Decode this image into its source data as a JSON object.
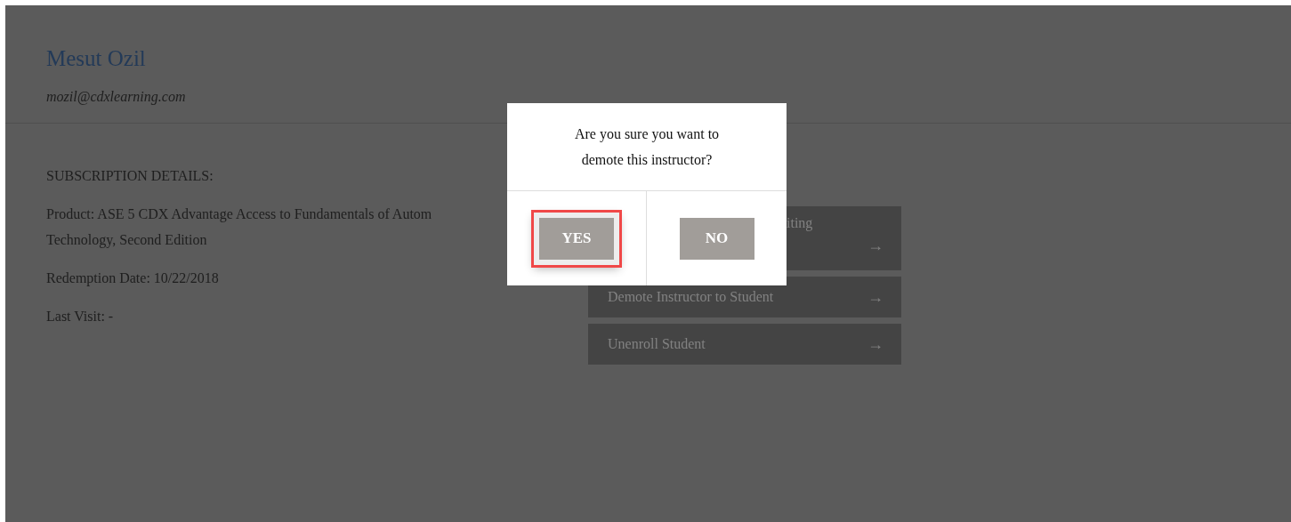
{
  "profile": {
    "name": "Mesut Ozil",
    "email": "mozil@cdxlearning.com"
  },
  "subscription": {
    "heading": "SUBSCRIPTION DETAILS:",
    "product_lines": [
      "Product: ASE 5 CDX Advantage Access to Fundamentals of Autom",
      "Technology, Second Edition"
    ],
    "redemption": "Redemption Date: 10/22/2018",
    "last_visit": "Last Visit: -"
  },
  "actions": [
    {
      "kind": "covered",
      "label": "iting",
      "arrow": "→"
    },
    {
      "kind": "full",
      "label": "Demote Instructor to Student",
      "arrow": "→"
    },
    {
      "kind": "full",
      "label": "Unenroll Student",
      "arrow": "→"
    }
  ],
  "dialog": {
    "message": "Are you sure you want to demote this instructor?",
    "buttons": [
      {
        "label": "YES",
        "highlighted": true
      },
      {
        "label": "NO",
        "highlighted": false
      }
    ]
  }
}
